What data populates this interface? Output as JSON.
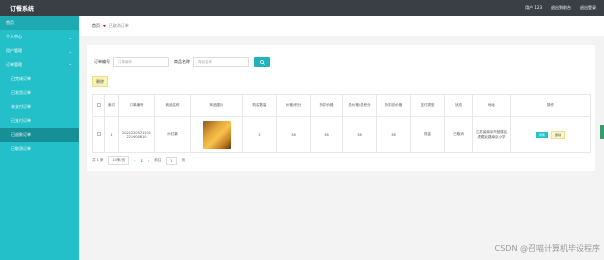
{
  "header": {
    "title": "订餐系统",
    "user_label": "用户 123",
    "nav_links": [
      "退出到前台",
      "退出登录"
    ]
  },
  "sidebar": {
    "items": [
      {
        "label": "首页"
      },
      {
        "label": "个人中心"
      },
      {
        "label": "用户管理"
      },
      {
        "label": "订单管理"
      },
      {
        "label": "已完成订单"
      },
      {
        "label": "已发货订单"
      },
      {
        "label": "未支付订单"
      },
      {
        "label": "已支付订单"
      },
      {
        "label": "已退款订单"
      },
      {
        "label": "已取消订单"
      }
    ]
  },
  "breadcrumb": {
    "home": "首页",
    "current": "已取消订单"
  },
  "filters": {
    "order_no_label": "订单编号",
    "order_no_placeholder": "订单编号",
    "product_label": "商品名称",
    "product_placeholder": "商品名称"
  },
  "delete_label": "删除",
  "table": {
    "headers": [
      "",
      "索引",
      "订单编号",
      "商品名称",
      "商品图片",
      "购买数量",
      "价格/积分",
      "折扣价格",
      "总价格/总积分",
      "折扣总价格",
      "支付类型",
      "状态",
      "地址",
      "操作"
    ],
    "rows": [
      {
        "index": "1",
        "order_no": "2021220571201221900610",
        "product": "炒红薯",
        "quantity": "2",
        "price": "38",
        "discount_price": "38",
        "total_price": "38",
        "discount_total": "38",
        "pay_type": "现金",
        "status": "已取消",
        "address": "江苏省南京市鼓楼区虎踞北路南京小学",
        "view_label": "详情",
        "delete_label": "删除"
      }
    ]
  },
  "pager": {
    "total": "共 1 条",
    "page_size": "10条/页",
    "current": "1",
    "goto_label": "前往",
    "goto_value": "1",
    "page_suffix": "页"
  },
  "watermark": "CSDN @召喵计算机毕设程序"
}
